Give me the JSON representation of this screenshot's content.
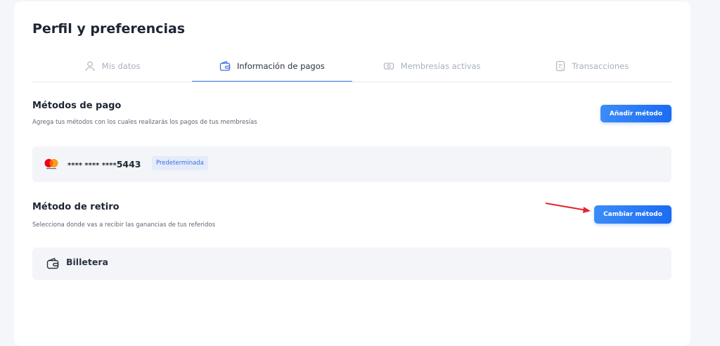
{
  "page": {
    "title": "Perfil y preferencias"
  },
  "tabs": [
    {
      "label": "Mis datos",
      "icon": "user-icon",
      "active": false
    },
    {
      "label": "Información de pagos",
      "icon": "wallet-icon",
      "active": true
    },
    {
      "label": "Membresías activas",
      "icon": "ticket-icon",
      "active": false
    },
    {
      "label": "Transacciones",
      "icon": "document-icon",
      "active": false
    }
  ],
  "payment_methods": {
    "title": "Métodos de pago",
    "description": "Agrega tus métodos con los cuales realizarás los pagos de tus membresías",
    "add_button": "Añadir método",
    "card": {
      "brand_icon": "mastercard-icon",
      "number_masked": "**** **** ****",
      "last4": "5443",
      "badge": "Predeterminada"
    }
  },
  "withdrawal": {
    "title": "Método de retiro",
    "description": "Selecciona donde vas a recibir las ganancias de tus referidos",
    "change_button": "Cambiar método",
    "method": {
      "icon": "wallet-icon",
      "label": "Billetera"
    }
  },
  "colors": {
    "accent": "#1b6cf2",
    "active_tab_line": "#3e78f0",
    "annotation_arrow": "#e3262d",
    "card_bg": "#f3f5f8"
  }
}
